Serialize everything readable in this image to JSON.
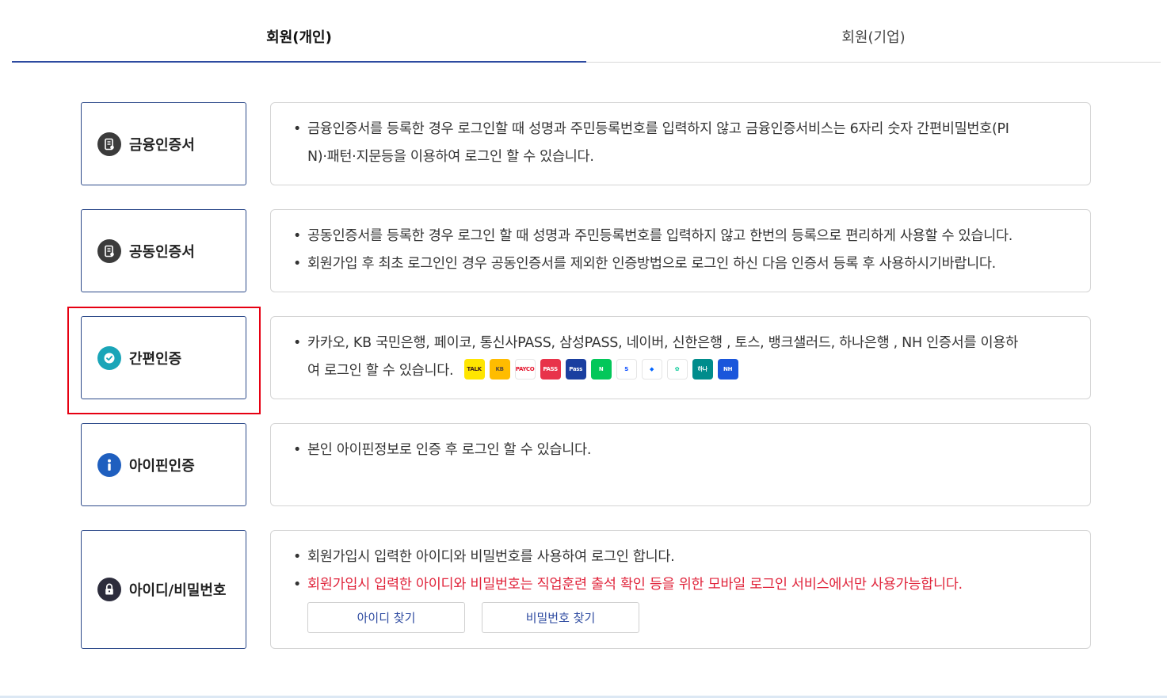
{
  "tabs": [
    {
      "label": "회원(개인)",
      "active": true
    },
    {
      "label": "회원(기업)",
      "active": false
    }
  ],
  "methods": [
    {
      "label": "금융인증서",
      "icon": "certificate-icon",
      "lines": [
        "금융인증서를 등록한 경우 로그인할 때 성명과 주민등록번호를 입력하지 않고 금융인증서비스는 6자리 숫자 간편비밀번호(PI",
        "N)·패턴·지문등을 이용하여 로그인 할 수 있습니다."
      ]
    },
    {
      "label": "공동인증서",
      "icon": "certificate-icon",
      "lines": [
        "공동인증서를 등록한 경우 로그인 할 때 성명과 주민등록번호를 입력하지 않고 한번의 등록으로 편리하게 사용할 수 있습니다.",
        "회원가입 후 최초 로그인인 경우 공동인증서를 제외한 인증방법으로 로그인 하신 다음 인증서 등록 후 사용하시기바랍니다."
      ]
    },
    {
      "label": "간편인증",
      "icon": "check-circle-icon",
      "lines": [
        "카카오, KB 국민은행, 페이코, 통신사PASS, 삼성PASS, 네이버, 신한은행 , 토스, 뱅크샐러드, 하나은행 , NH 인증서를 이용하",
        "여 로그인 할 수 있습니다."
      ],
      "logos": [
        {
          "name": "kakao-logo-icon",
          "text": "TALK",
          "bg": "#fee500",
          "fg": "#3c1e1e"
        },
        {
          "name": "kb-logo-icon",
          "text": "KB",
          "bg": "#ffbc00",
          "fg": "#5a4a3a"
        },
        {
          "name": "payco-logo-icon",
          "text": "PAYCO",
          "bg": "#ffffff",
          "fg": "#e4122a"
        },
        {
          "name": "pass-logo-icon",
          "text": "PASS",
          "bg": "#e8334a",
          "fg": "#ffffff"
        },
        {
          "name": "samsung-pass-logo-icon",
          "text": "Pass",
          "bg": "#1a3fa0",
          "fg": "#ffffff"
        },
        {
          "name": "naver-logo-icon",
          "text": "N",
          "bg": "#03c75a",
          "fg": "#ffffff"
        },
        {
          "name": "shinhan-logo-icon",
          "text": "S",
          "bg": "#ffffff",
          "fg": "#0046ff"
        },
        {
          "name": "toss-logo-icon",
          "text": "◆",
          "bg": "#ffffff",
          "fg": "#0064ff"
        },
        {
          "name": "banksalad-logo-icon",
          "text": "✿",
          "bg": "#ffffff",
          "fg": "#00c896"
        },
        {
          "name": "hana-logo-icon",
          "text": "하나",
          "bg": "#008c8c",
          "fg": "#ffffff"
        },
        {
          "name": "nh-logo-icon",
          "text": "NH",
          "bg": "#1a56db",
          "fg": "#ffffff"
        }
      ]
    },
    {
      "label": "아이핀인증",
      "icon": "info-icon",
      "lines": [
        "본인 아이핀정보로 인증 후 로그인 할 수 있습니다."
      ]
    },
    {
      "label": "아이디/비밀번호",
      "icon": "lock-icon",
      "lines": [
        "회원가입시 입력한 아이디와 비밀번호를 사용하여 로그인 합니다."
      ],
      "red_line": "회원가입시 입력한 아이디와 비밀번호는 직업훈련 출석 확인 등을 위한 모바일 로그인 서비스에서만 사용가능합니다.",
      "buttons": [
        "아이디 찾기",
        "비밀번호 찾기"
      ]
    }
  ],
  "colors": {
    "accent": "#2d4aa0",
    "highlight": "#e60012",
    "warning_text": "#e0243b",
    "teal_icon": "#1aa5b8",
    "dark_icon": "#3b3b3b",
    "blue_icon": "#1f5fbf"
  }
}
